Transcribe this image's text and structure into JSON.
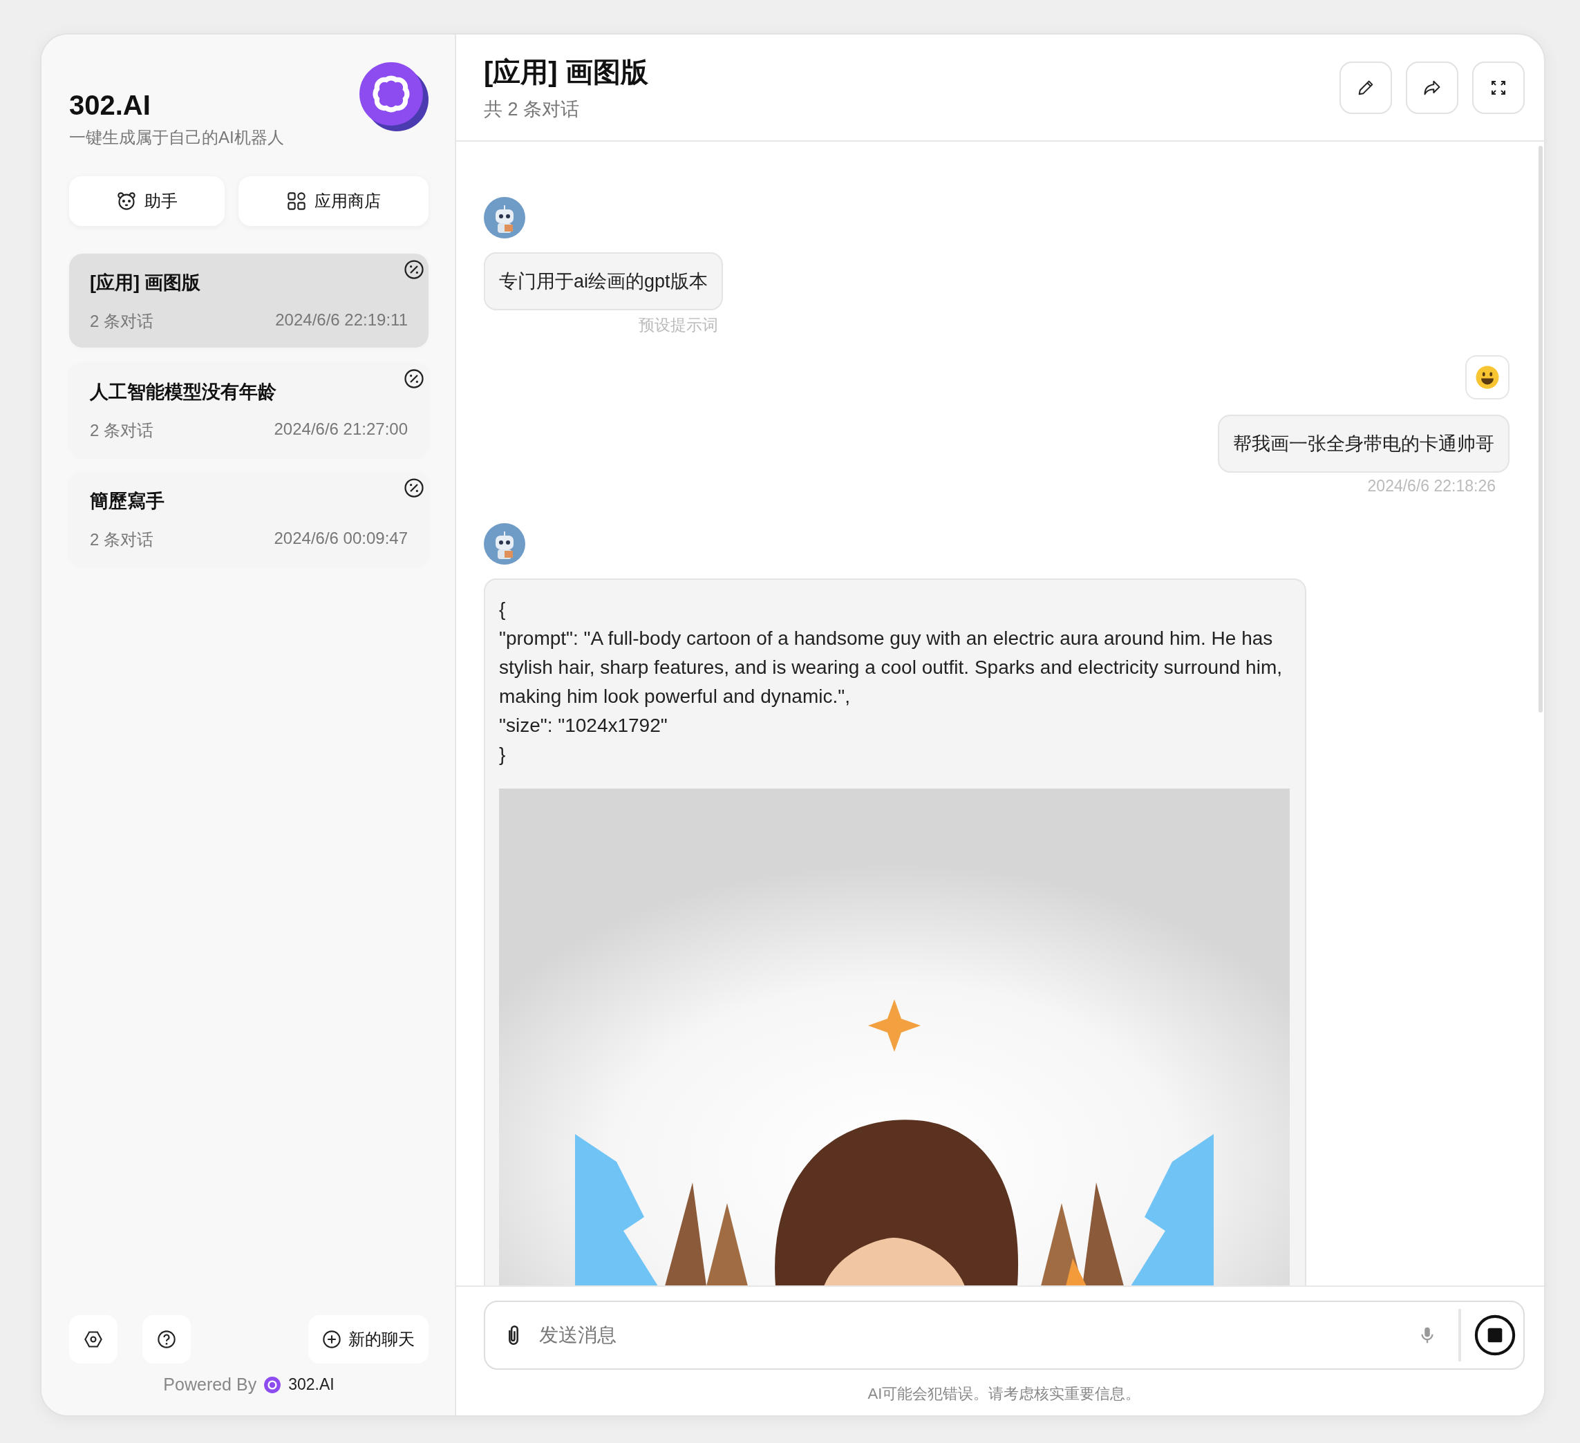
{
  "sidebar": {
    "brand": "302.AI",
    "tagline": "一键生成属于自己的AI机器人",
    "nav_buttons": [
      {
        "kind": "assistant",
        "label": "助手"
      },
      {
        "kind": "store",
        "label": "应用商店"
      }
    ],
    "chats": [
      {
        "title": "[应用] 画图版",
        "count": "2 条对话",
        "time": "2024/6/6 22:19:11",
        "selected": true
      },
      {
        "title": "人工智能模型没有年龄",
        "count": "2 条对话",
        "time": "2024/6/6 21:27:00",
        "selected": false
      },
      {
        "title": "簡歷寫手",
        "count": "2 条对话",
        "time": "2024/6/6 00:09:47",
        "selected": false
      }
    ],
    "new_chat": "新的聊天",
    "powered_by": "Powered By",
    "powered_brand": "302.AI"
  },
  "chat": {
    "title": "[应用] 画图版",
    "subtitle": "共 2 条对话",
    "messages": [
      {
        "kind": "bot_text",
        "text": "专门用于ai绘画的gpt版本",
        "caption": "预设提示词"
      },
      {
        "kind": "user_text",
        "text": "帮我画一张全身带电的卡通帅哥",
        "caption": "2024/6/6 22:18:26"
      },
      {
        "kind": "bot_image",
        "lines": [
          "{",
          "\"prompt\": \"A full-body cartoon of a handsome guy with an electric aura around him. He has stylish hair, sharp features, and is wearing a cool outfit. Sparks and electricity surround him, making him look powerful and dynamic.\",",
          "\"size\": \"1024x1792\"",
          "}"
        ]
      }
    ],
    "input": {
      "placeholder": "发送消息"
    },
    "disclaimer": "AI可能会犯错误。请考虑核实重要信息。"
  }
}
